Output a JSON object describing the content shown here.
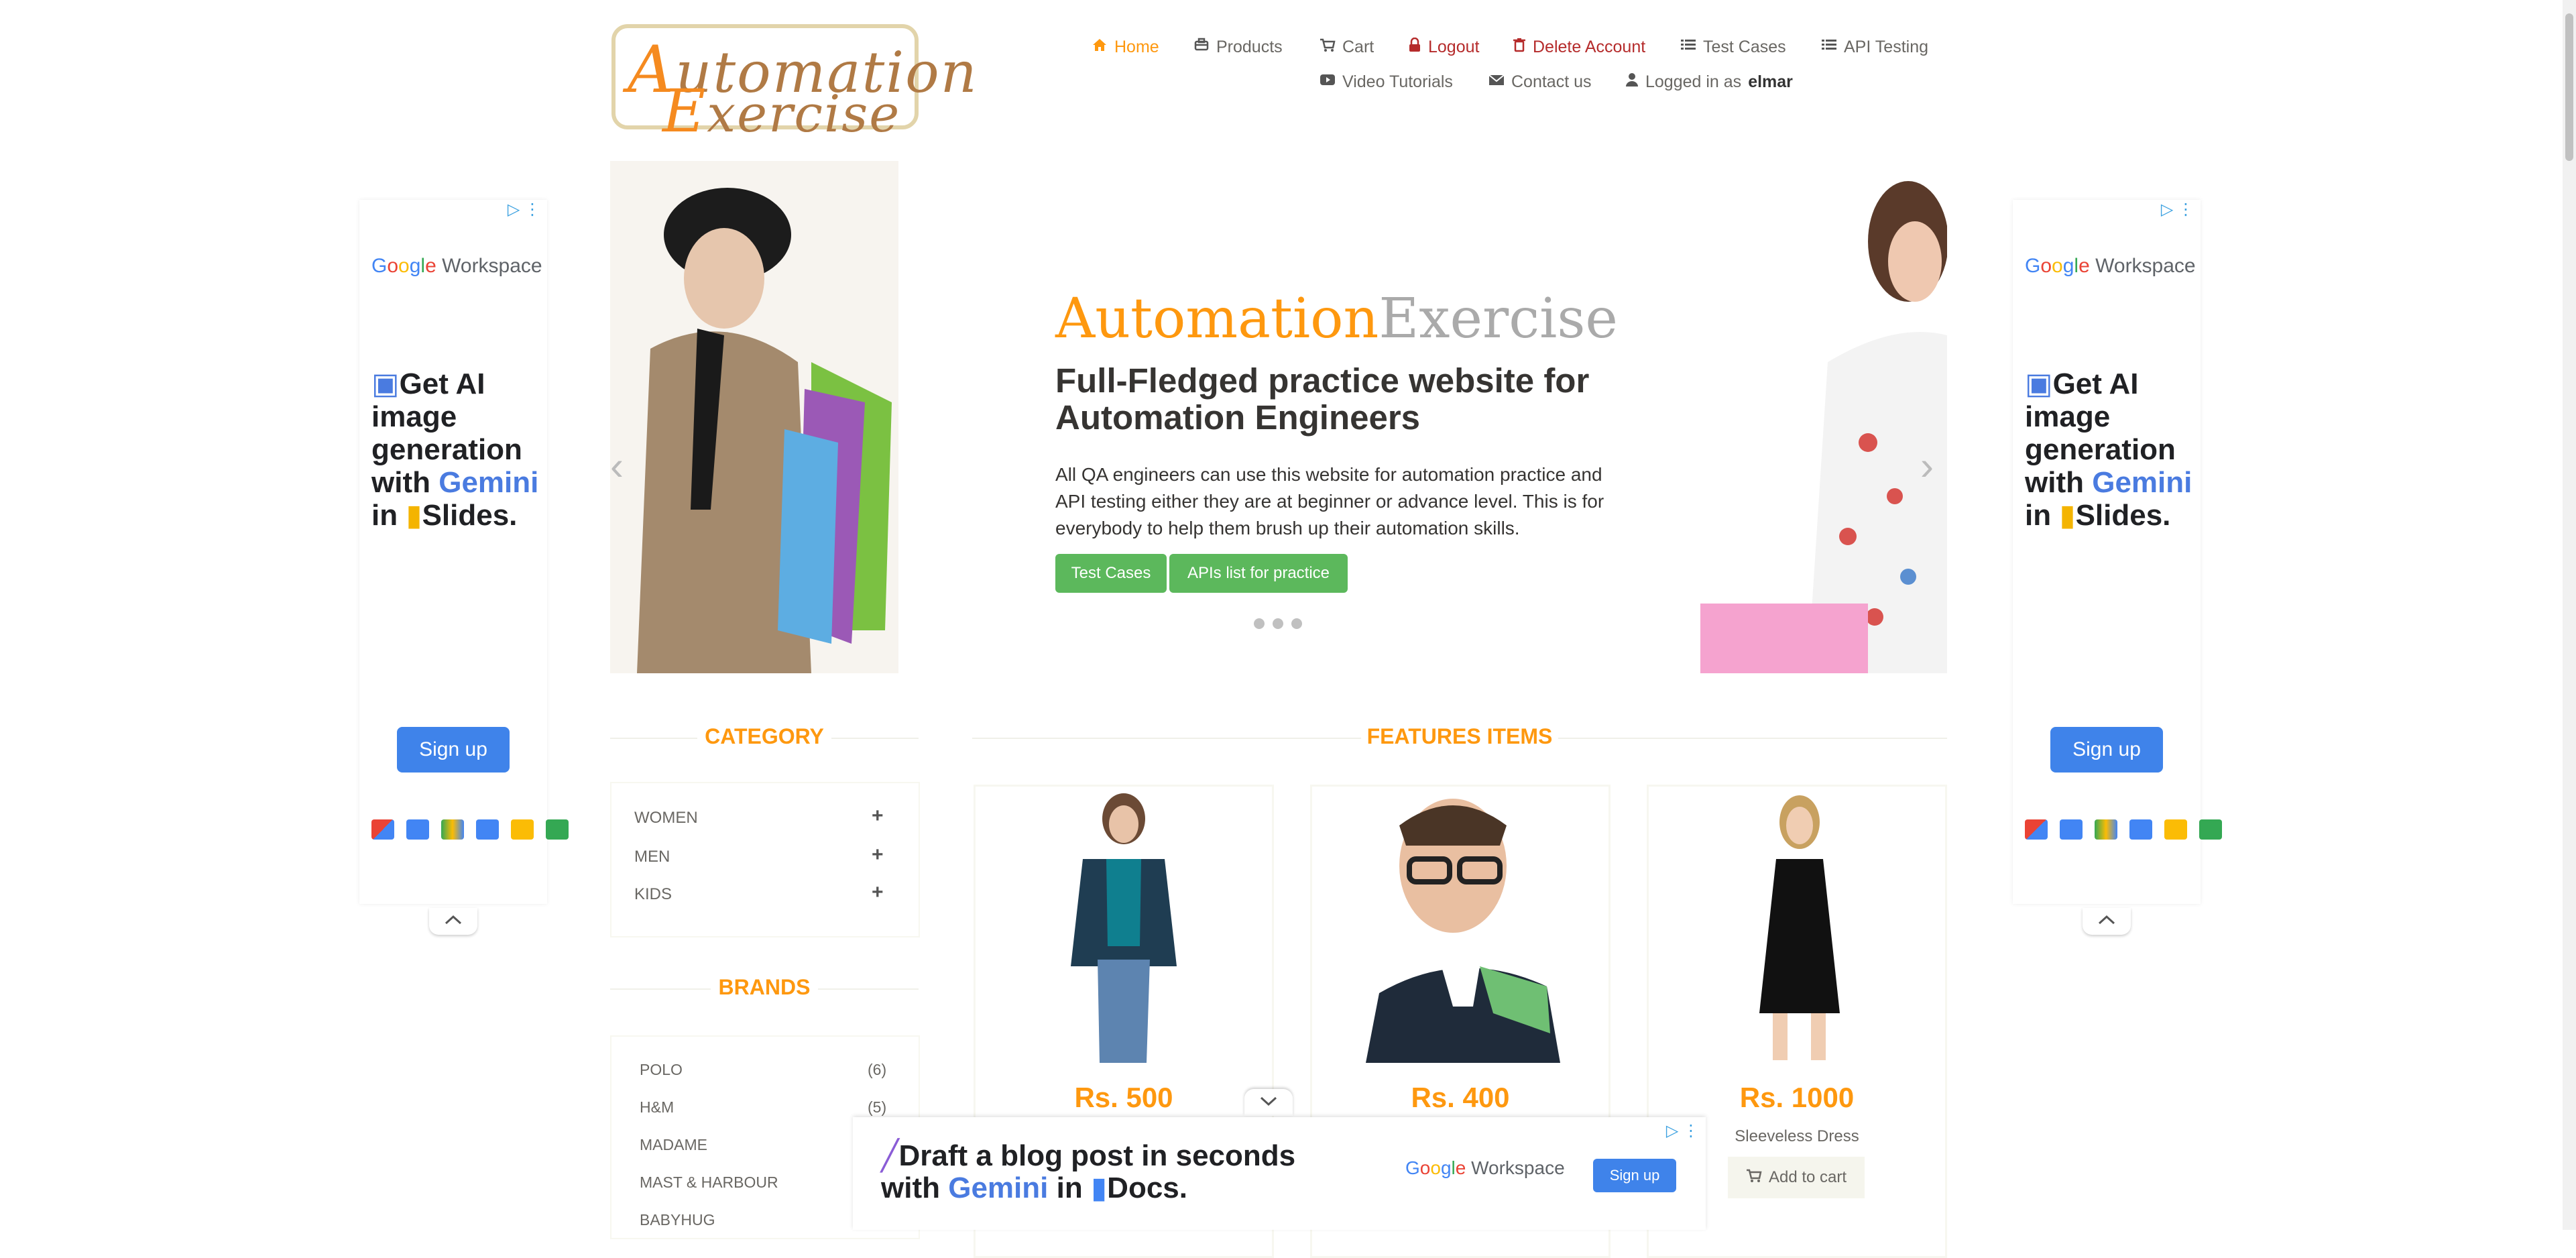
{
  "logo": {
    "line1_cap": "A",
    "line1_rest": "utomation",
    "line2_cap": "E",
    "line2_rest": "xercise"
  },
  "nav": {
    "home": "Home",
    "products": "Products",
    "cart": "Cart",
    "logout": "Logout",
    "delete_account": "Delete Account",
    "test_cases": "Test Cases",
    "api_testing": "API Testing",
    "video_tutorials": "Video Tutorials",
    "contact_us": "Contact us",
    "logged_in_prefix": "Logged in as",
    "username": "elmar"
  },
  "side_ad": {
    "brand_g": [
      "G",
      "o",
      "o",
      "g",
      "l",
      "e"
    ],
    "brand_rest": "Workspace",
    "headline_1": "Get AI image generation with",
    "headline_gem": "Gemini",
    "headline_2": "in",
    "headline_3": "Slides.",
    "signup": "Sign up"
  },
  "slider": {
    "title_a": "Automation",
    "title_b": "Exercise",
    "subtitle": "Full-Fledged practice website for Automation Engineers",
    "description": "All QA engineers can use this website for automation practice and API testing either they are at beginner or advance level. This is for everybody to help them brush up their automation skills.",
    "btn_test_cases": "Test Cases",
    "btn_apis": "APIs list for practice",
    "prev": "‹",
    "next": "›"
  },
  "category": {
    "title": "CATEGORY",
    "items": [
      "WOMEN",
      "MEN",
      "KIDS"
    ]
  },
  "brands": {
    "title": "BRANDS",
    "items": [
      {
        "name": "POLO",
        "count": "(6)"
      },
      {
        "name": "H&M",
        "count": "(5)"
      },
      {
        "name": "MADAME",
        "count": ""
      },
      {
        "name": "MAST & HARBOUR",
        "count": ""
      },
      {
        "name": "BABYHUG",
        "count": ""
      }
    ]
  },
  "features": {
    "title": "FEATURES ITEMS",
    "products": [
      {
        "price": "Rs. 500",
        "name": ""
      },
      {
        "price": "Rs. 400",
        "name": ""
      },
      {
        "price": "Rs. 1000",
        "name": "Sleeveless Dress",
        "add_to_cart": "Add to cart"
      }
    ]
  },
  "bottom_ad": {
    "line1": "Draft a blog post in seconds",
    "line2a": "with",
    "line2gem": "Gemini",
    "line2b": "in",
    "line2c": "Docs.",
    "brand_rest": "Workspace",
    "signup": "Sign up"
  }
}
